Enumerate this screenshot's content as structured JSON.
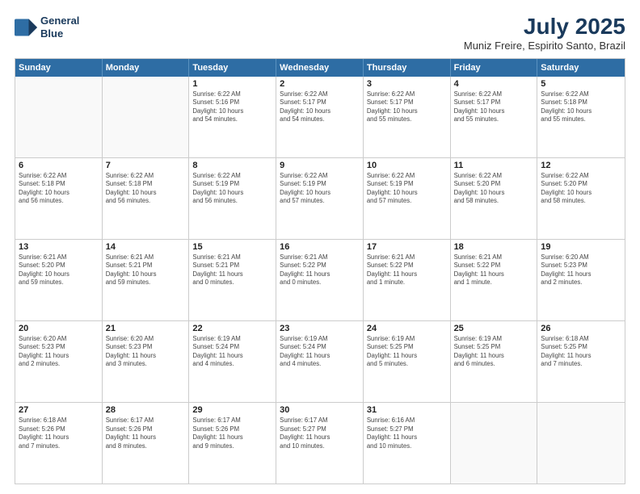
{
  "header": {
    "logo_line1": "General",
    "logo_line2": "Blue",
    "title": "July 2025",
    "subtitle": "Muniz Freire, Espirito Santo, Brazil"
  },
  "weekdays": [
    "Sunday",
    "Monday",
    "Tuesday",
    "Wednesday",
    "Thursday",
    "Friday",
    "Saturday"
  ],
  "rows": [
    [
      {
        "day": "",
        "info": ""
      },
      {
        "day": "",
        "info": ""
      },
      {
        "day": "1",
        "info": "Sunrise: 6:22 AM\nSunset: 5:16 PM\nDaylight: 10 hours\nand 54 minutes."
      },
      {
        "day": "2",
        "info": "Sunrise: 6:22 AM\nSunset: 5:17 PM\nDaylight: 10 hours\nand 54 minutes."
      },
      {
        "day": "3",
        "info": "Sunrise: 6:22 AM\nSunset: 5:17 PM\nDaylight: 10 hours\nand 55 minutes."
      },
      {
        "day": "4",
        "info": "Sunrise: 6:22 AM\nSunset: 5:17 PM\nDaylight: 10 hours\nand 55 minutes."
      },
      {
        "day": "5",
        "info": "Sunrise: 6:22 AM\nSunset: 5:18 PM\nDaylight: 10 hours\nand 55 minutes."
      }
    ],
    [
      {
        "day": "6",
        "info": "Sunrise: 6:22 AM\nSunset: 5:18 PM\nDaylight: 10 hours\nand 56 minutes."
      },
      {
        "day": "7",
        "info": "Sunrise: 6:22 AM\nSunset: 5:18 PM\nDaylight: 10 hours\nand 56 minutes."
      },
      {
        "day": "8",
        "info": "Sunrise: 6:22 AM\nSunset: 5:19 PM\nDaylight: 10 hours\nand 56 minutes."
      },
      {
        "day": "9",
        "info": "Sunrise: 6:22 AM\nSunset: 5:19 PM\nDaylight: 10 hours\nand 57 minutes."
      },
      {
        "day": "10",
        "info": "Sunrise: 6:22 AM\nSunset: 5:19 PM\nDaylight: 10 hours\nand 57 minutes."
      },
      {
        "day": "11",
        "info": "Sunrise: 6:22 AM\nSunset: 5:20 PM\nDaylight: 10 hours\nand 58 minutes."
      },
      {
        "day": "12",
        "info": "Sunrise: 6:22 AM\nSunset: 5:20 PM\nDaylight: 10 hours\nand 58 minutes."
      }
    ],
    [
      {
        "day": "13",
        "info": "Sunrise: 6:21 AM\nSunset: 5:20 PM\nDaylight: 10 hours\nand 59 minutes."
      },
      {
        "day": "14",
        "info": "Sunrise: 6:21 AM\nSunset: 5:21 PM\nDaylight: 10 hours\nand 59 minutes."
      },
      {
        "day": "15",
        "info": "Sunrise: 6:21 AM\nSunset: 5:21 PM\nDaylight: 11 hours\nand 0 minutes."
      },
      {
        "day": "16",
        "info": "Sunrise: 6:21 AM\nSunset: 5:22 PM\nDaylight: 11 hours\nand 0 minutes."
      },
      {
        "day": "17",
        "info": "Sunrise: 6:21 AM\nSunset: 5:22 PM\nDaylight: 11 hours\nand 1 minute."
      },
      {
        "day": "18",
        "info": "Sunrise: 6:21 AM\nSunset: 5:22 PM\nDaylight: 11 hours\nand 1 minute."
      },
      {
        "day": "19",
        "info": "Sunrise: 6:20 AM\nSunset: 5:23 PM\nDaylight: 11 hours\nand 2 minutes."
      }
    ],
    [
      {
        "day": "20",
        "info": "Sunrise: 6:20 AM\nSunset: 5:23 PM\nDaylight: 11 hours\nand 2 minutes."
      },
      {
        "day": "21",
        "info": "Sunrise: 6:20 AM\nSunset: 5:23 PM\nDaylight: 11 hours\nand 3 minutes."
      },
      {
        "day": "22",
        "info": "Sunrise: 6:19 AM\nSunset: 5:24 PM\nDaylight: 11 hours\nand 4 minutes."
      },
      {
        "day": "23",
        "info": "Sunrise: 6:19 AM\nSunset: 5:24 PM\nDaylight: 11 hours\nand 4 minutes."
      },
      {
        "day": "24",
        "info": "Sunrise: 6:19 AM\nSunset: 5:25 PM\nDaylight: 11 hours\nand 5 minutes."
      },
      {
        "day": "25",
        "info": "Sunrise: 6:19 AM\nSunset: 5:25 PM\nDaylight: 11 hours\nand 6 minutes."
      },
      {
        "day": "26",
        "info": "Sunrise: 6:18 AM\nSunset: 5:25 PM\nDaylight: 11 hours\nand 7 minutes."
      }
    ],
    [
      {
        "day": "27",
        "info": "Sunrise: 6:18 AM\nSunset: 5:26 PM\nDaylight: 11 hours\nand 7 minutes."
      },
      {
        "day": "28",
        "info": "Sunrise: 6:17 AM\nSunset: 5:26 PM\nDaylight: 11 hours\nand 8 minutes."
      },
      {
        "day": "29",
        "info": "Sunrise: 6:17 AM\nSunset: 5:26 PM\nDaylight: 11 hours\nand 9 minutes."
      },
      {
        "day": "30",
        "info": "Sunrise: 6:17 AM\nSunset: 5:27 PM\nDaylight: 11 hours\nand 10 minutes."
      },
      {
        "day": "31",
        "info": "Sunrise: 6:16 AM\nSunset: 5:27 PM\nDaylight: 11 hours\nand 10 minutes."
      },
      {
        "day": "",
        "info": ""
      },
      {
        "day": "",
        "info": ""
      }
    ]
  ]
}
